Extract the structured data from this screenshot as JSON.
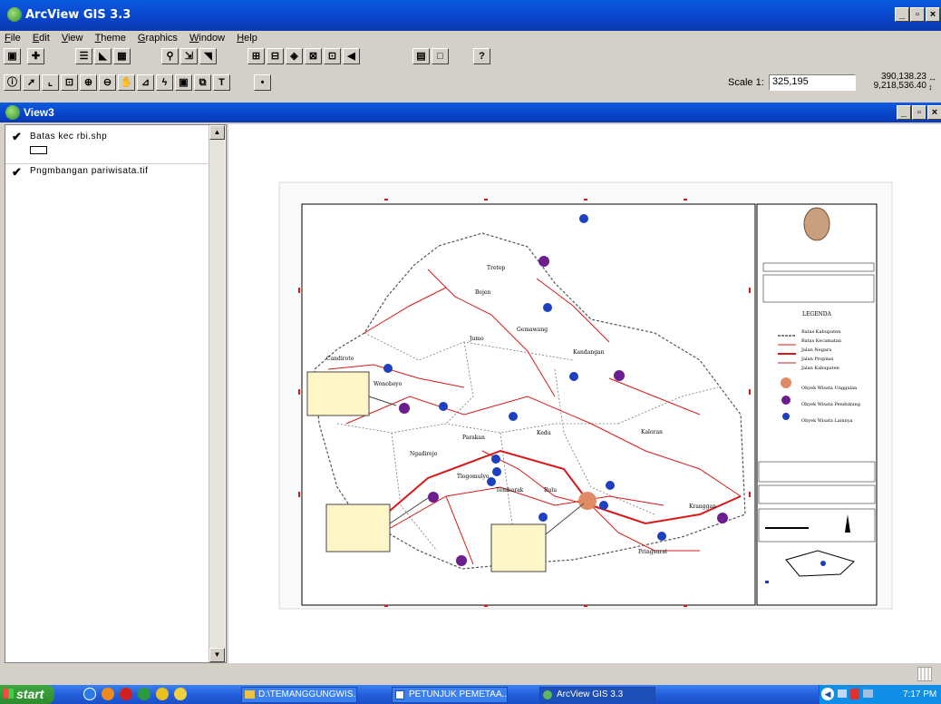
{
  "app": {
    "title": "ArcView GIS 3.3"
  },
  "menu": [
    "File",
    "Edit",
    "View",
    "Theme",
    "Graphics",
    "Window",
    "Help"
  ],
  "scale": {
    "label": "Scale 1:",
    "value": "325,195"
  },
  "coords": {
    "x": "390,138.23",
    "y": "9,218,536.40"
  },
  "view": {
    "title": "View3"
  },
  "toc": {
    "themes": [
      {
        "label": "Batas kec rbi.shp",
        "checked": true
      },
      {
        "label": "Pngmbangan pariwisata.tif",
        "checked": true
      }
    ]
  },
  "map": {
    "subdistricts": [
      "Candiroto",
      "Jumo",
      "Gemawang",
      "Kandangan",
      "Kedu",
      "Kaloran",
      "Kranggan",
      "Pringsurat",
      "Parakan",
      "Bulu",
      "Tembarak",
      "Tlogomulyo",
      "Ngadirejo",
      "Wonoboyo",
      "Bejen",
      "Tretep"
    ],
    "legend_title": "LEGENDA",
    "legend_items": [
      "Batas Kabupaten",
      "Batas Kecamatan",
      "Jalan Negara",
      "Jalan Propinsi",
      "Jalan Kabupaten",
      "Obyek Wisata Unggulan",
      "Obyek Wisata Pendukung",
      "Obyek Wisata Lainnya"
    ]
  },
  "taskbar": {
    "start": "start",
    "tasks": [
      "D:\\TEMANGGUNGWIS...",
      "PETUNJUK PEMETAA...",
      "ArcView GIS 3.3"
    ],
    "clock": "7:17 PM"
  },
  "colors": {
    "title_blue": "#0843c8",
    "road_red": "#d81818",
    "desktop_gray": "#d4d0c8"
  }
}
